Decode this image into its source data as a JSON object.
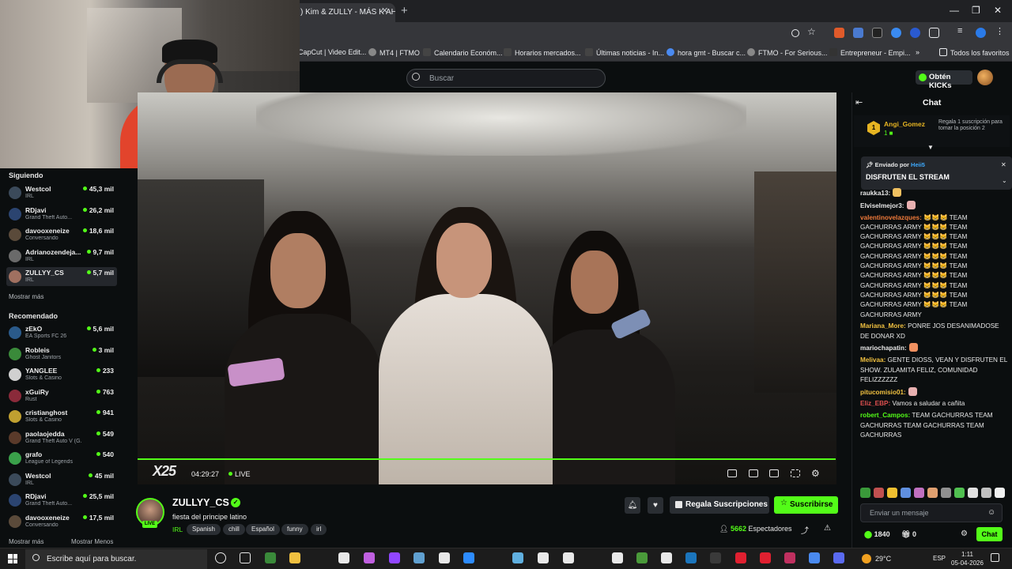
{
  "browser": {
    "tab_title": ") Kim & ZULLY - MÁS K AH",
    "bookmarks": [
      "CapCut | Video Edit...",
      "MT4 | FTMO",
      "Calendario Económ...",
      "Horarios mercados...",
      "Últimas noticias - In...",
      "hora gmt - Buscar c...",
      "FTMO - For Serious...",
      "Entrepreneur - Empi..."
    ],
    "all_bookmarks": "Todos los favoritos"
  },
  "header": {
    "search_placeholder": "Buscar",
    "kicks_label": "Obtén KICKs"
  },
  "sidebar": {
    "following_title": "Siguiendo",
    "following": [
      {
        "name": "Westcol",
        "category": "IRL",
        "viewers": "45,3 mil",
        "color": "#3b4a5a"
      },
      {
        "name": "RDjavi",
        "category": "Grand Theft Auto...",
        "viewers": "26,2 mil",
        "color": "#2b4470"
      },
      {
        "name": "davooxeneize",
        "category": "Conversando",
        "viewers": "18,6 mil",
        "color": "#5a4a3a"
      },
      {
        "name": "Adrianozendeja...",
        "category": "IRL",
        "viewers": "9,7 mil",
        "color": "#6a6a6a"
      },
      {
        "name": "ZULLYY_CS",
        "category": "IRL",
        "viewers": "5,7 mil",
        "color": "#a07060"
      }
    ],
    "show_more": "Mostrar más",
    "recommended_title": "Recomendado",
    "recommended": [
      {
        "name": "zEkO",
        "category": "EA Sports FC 26",
        "viewers": "5,6 mil",
        "color": "#2a5a8a"
      },
      {
        "name": "Robleis",
        "category": "Ghost Janitors",
        "viewers": "3 mil",
        "color": "#3a8a3a"
      },
      {
        "name": "YANGLEE",
        "category": "Slots & Casino",
        "viewers": "233",
        "color": "#d0d0d0"
      },
      {
        "name": "xGuiRy",
        "category": "Rust",
        "viewers": "763",
        "color": "#8a2a3a"
      },
      {
        "name": "cristianghost",
        "category": "Slots & Casino",
        "viewers": "941",
        "color": "#c0a030"
      },
      {
        "name": "paolaojedda",
        "category": "Grand Theft Auto V (G...",
        "viewers": "549",
        "color": "#5a3a2a"
      },
      {
        "name": "grafo",
        "category": "League of Legends",
        "viewers": "540",
        "color": "#3aa04a"
      },
      {
        "name": "Westcol",
        "category": "IRL",
        "viewers": "45 mil",
        "color": "#3b4a5a"
      },
      {
        "name": "RDjavi",
        "category": "Grand Theft Auto...",
        "viewers": "25,5 mil",
        "color": "#2b4470"
      },
      {
        "name": "davooxeneize",
        "category": "Conversando",
        "viewers": "17,5 mil",
        "color": "#5a4a3a"
      }
    ],
    "show_more_2": "Mostrar más",
    "show_less": "Mostrar Menos"
  },
  "player": {
    "time": "04:29:27",
    "live": "LIVE",
    "logo": "X25"
  },
  "stream": {
    "channel": "ZULLYY_CS",
    "live_badge": "LIVE",
    "title": "fiesta del  principe latino",
    "category": "IRL",
    "tags": [
      "Spanish",
      "chill",
      "Español",
      "funny",
      "irl"
    ],
    "gift_button": "Regala Suscripciones",
    "subscribe_button": "Suscribirse",
    "viewers_count": "5662",
    "viewers_label": "Espectadores"
  },
  "chat": {
    "title": "Chat",
    "gifter": {
      "name": "Angi_Gomez",
      "rank": "1",
      "count": "1",
      "message": "Regala 1 suscripción para tomar la posición 2"
    },
    "pinned_by_label": "Enviado por",
    "pinned_by_user": "Heii5",
    "pinned_text": "DISFRUTEN EL STREAM",
    "messages": [
      {
        "user": "raukka13:",
        "color": "#e8e8e8",
        "text": ""
      },
      {
        "user": "Elviselmejor3:",
        "color": "#e8e8e8",
        "text": ""
      },
      {
        "user": "valentinovelazques:",
        "color": "#f07a3a",
        "text": "😸😸😸 TEAM GACHURRAS ARMY 😸😸😸 TEAM GACHURRAS ARMY 😸😸😸 TEAM GACHURRAS ARMY 😸😸😸 TEAM GACHURRAS ARMY 😸😸😸 TEAM GACHURRAS ARMY 😸😸😸 TEAM GACHURRAS ARMY 😸😸😸 TEAM GACHURRAS ARMY 😸😸😸 TEAM GACHURRAS ARMY 😸😸😸 TEAM GACHURRAS ARMY 😸😸😸 TEAM GACHURRAS ARMY"
      },
      {
        "user": "Mariana_More:",
        "color": "#f0c040",
        "text": "PONRE JOS DESANIMADOSE DE DONAR XD"
      },
      {
        "user": "mariochapatin:",
        "color": "#e8e8e8",
        "text": ""
      },
      {
        "user": "Melivaa:",
        "color": "#f0c040",
        "text": "GENTE DIOSS, VEAN Y DISFRUTEN EL SHOW. ZULAMITA FELIZ, COMUNIDAD FELIZZZZZZ"
      },
      {
        "user": "pitucomisio01:",
        "color": "#f0c040",
        "text": ""
      },
      {
        "user": "Eliz_EBP:",
        "color": "#e05050",
        "text": "Vamos a saludar a cañita"
      },
      {
        "user": "robert_Campos:",
        "color": "#53fc18",
        "text": "TEAM GACHURRAS TEAM GACHURRAS TEAM GACHURRAS TEAM GACHURRAS"
      }
    ],
    "input_placeholder": "Enviar un mensaje",
    "points": "1840",
    "gifts": "0",
    "send_button": "Chat"
  },
  "taskbar": {
    "search_placeholder": "Escribe aquí para buscar.",
    "weather": "29°C",
    "lang": "ESP",
    "time": "1:11",
    "date": "05-04-2026"
  }
}
